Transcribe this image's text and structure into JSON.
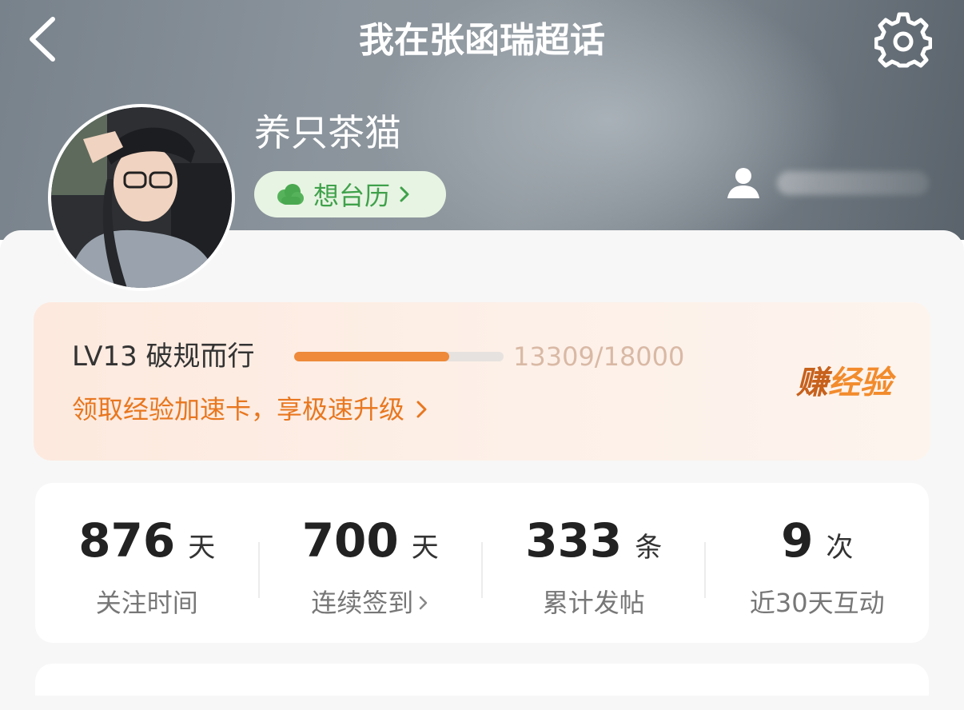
{
  "header": {
    "title": "我在张函瑞超话",
    "back_icon": "chevron-left-icon",
    "settings_icon": "gear-icon"
  },
  "profile": {
    "username": "养只茶猫",
    "calendar_label": "想台历",
    "calendar_icon": "cloud-icon",
    "visitor_icon": "person-icon"
  },
  "level": {
    "name": "LV13 破规而行",
    "progress_text": "13309/18000",
    "progress_fraction": 0.7394,
    "speedup_link": "领取经验加速卡，享极速升级",
    "earn_part1": "赚",
    "earn_part2": "经验"
  },
  "stats": [
    {
      "value": "876",
      "unit": "天",
      "label": "关注时间",
      "has_chevron": false
    },
    {
      "value": "700",
      "unit": "天",
      "label": "连续签到",
      "has_chevron": true
    },
    {
      "value": "333",
      "unit": "条",
      "label": "累计发帖",
      "has_chevron": false
    },
    {
      "value": "9",
      "unit": "次",
      "label": "近30天互动",
      "has_chevron": false
    }
  ],
  "colors": {
    "accent_orange": "#ee8a3a",
    "pill_green": "#3fa14b",
    "link_orange": "#e8771f"
  }
}
